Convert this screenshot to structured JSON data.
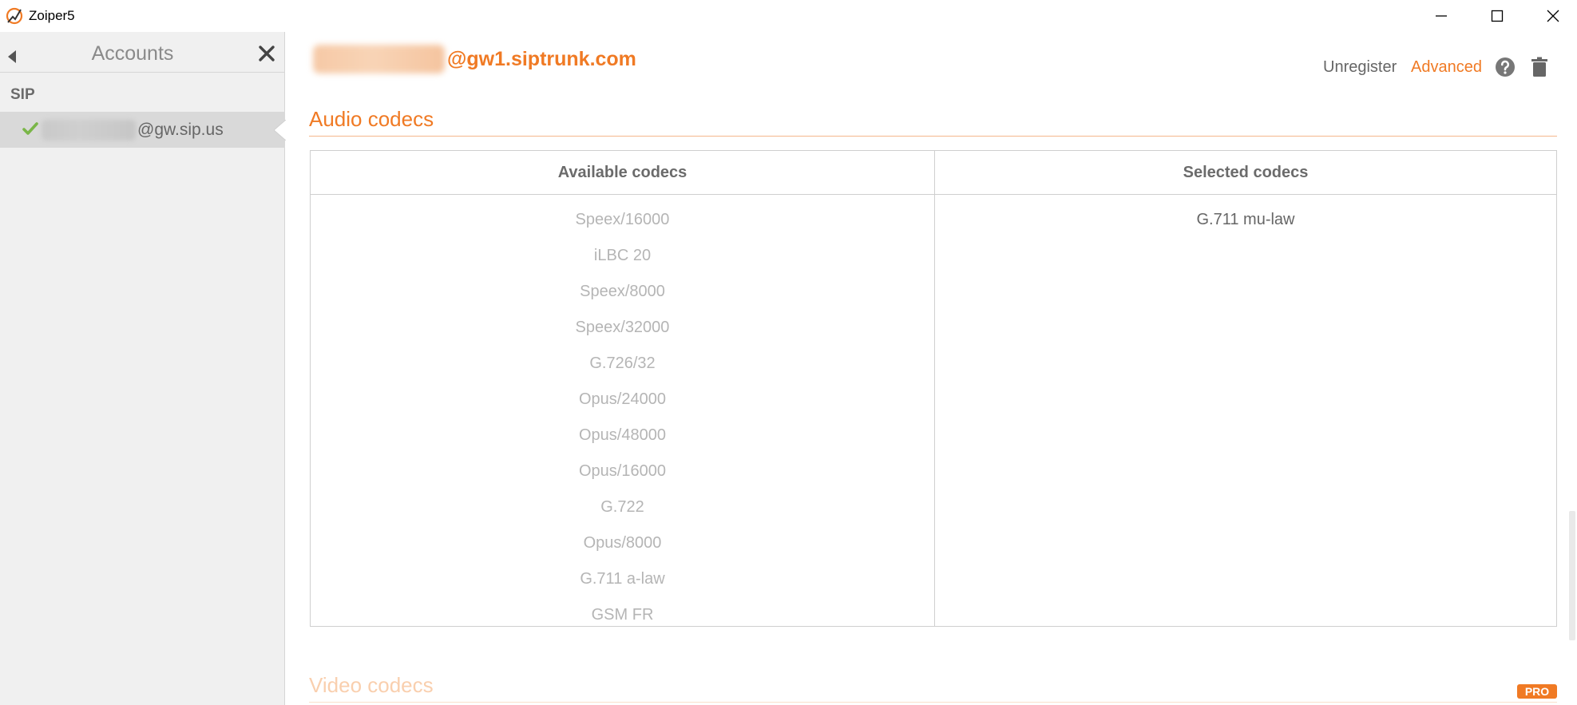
{
  "window": {
    "title": "Zoiper5"
  },
  "sidebar": {
    "title": "Accounts",
    "section": "SIP",
    "account": {
      "domain": "@gw.sip.us"
    }
  },
  "header": {
    "account_domain": "@gw1.siptrunk.com",
    "unregister_label": "Unregister",
    "advanced_label": "Advanced"
  },
  "audio_codecs": {
    "title": "Audio codecs",
    "available_header": "Available codecs",
    "selected_header": "Selected codecs",
    "available": [
      "Speex/16000",
      "iLBC 20",
      "Speex/8000",
      "Speex/32000",
      "G.726/32",
      "Opus/24000",
      "Opus/48000",
      "Opus/16000",
      "G.722",
      "Opus/8000",
      "G.711 a-law",
      "GSM FR"
    ],
    "selected": [
      "G.711 mu-law"
    ]
  },
  "video_codecs": {
    "title": "Video codecs",
    "badge": "PRO"
  },
  "colors": {
    "accent": "#f07a24",
    "check": "#7ab648"
  }
}
